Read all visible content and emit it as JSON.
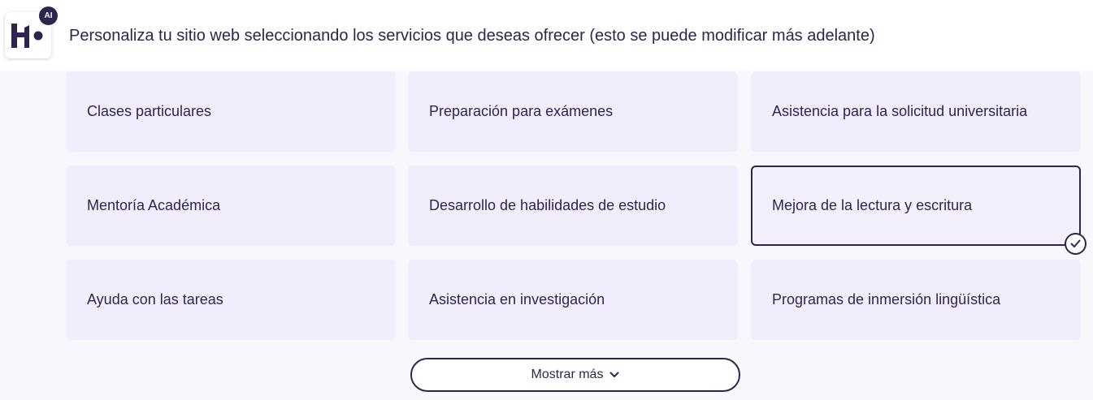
{
  "header": {
    "logo_icon": "hostinger-logo-icon",
    "ai_badge": "AI",
    "prompt": "Personaliza tu sitio web seleccionando los servicios que deseas ofrecer (esto se puede modificar más adelante)"
  },
  "services": [
    {
      "label": "Clases particulares",
      "selected": false
    },
    {
      "label": "Preparación para exámenes",
      "selected": false
    },
    {
      "label": "Asistencia para la solicitud universitaria",
      "selected": false
    },
    {
      "label": "Mentoría Académica",
      "selected": false
    },
    {
      "label": "Desarrollo de habilidades de estudio",
      "selected": false
    },
    {
      "label": "Mejora de la lectura y escritura",
      "selected": true
    },
    {
      "label": "Ayuda con las tareas",
      "selected": false
    },
    {
      "label": "Asistencia en investigación",
      "selected": false
    },
    {
      "label": "Programas de inmersión lingüística",
      "selected": false
    }
  ],
  "show_more": {
    "label": "Mostrar más",
    "icon": "chevron-down-icon"
  },
  "colors": {
    "primary": "#2d2550",
    "card_bg": "#f2edfc",
    "panel_bg": "#f8f7fb"
  }
}
